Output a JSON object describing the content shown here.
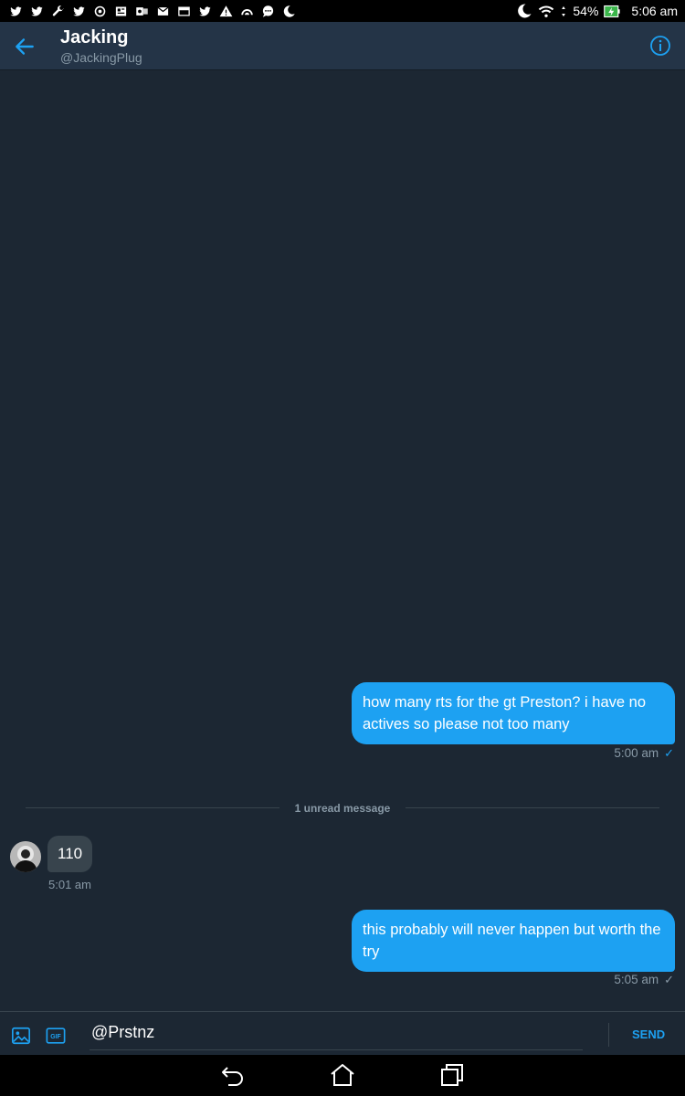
{
  "status_bar": {
    "left_icons": [
      "twitter-icon",
      "twitter-icon",
      "wrench-icon",
      "twitter-icon",
      "sync-icon",
      "news-icon",
      "outlook-icon",
      "mail-icon",
      "mail-icon",
      "twitter-icon",
      "warning-icon",
      "rainbow-icon",
      "chat-icon",
      "moon-icon"
    ],
    "battery_percent": "54%",
    "time": "5:06 am"
  },
  "header": {
    "name": "Jacking",
    "handle": "@JackingPlug"
  },
  "messages": {
    "m1": {
      "text": "how many rts for the gt Preston? i have no actives so please not too many",
      "time": "5:00 am",
      "check": "✓"
    },
    "unread_label": "1 unread message",
    "m2": {
      "text": "110",
      "time": "5:01 am"
    },
    "m3": {
      "text": "this probably will never happen but worth the try",
      "time": "5:05 am",
      "check": "✓"
    }
  },
  "composer": {
    "value": "@Prstnz",
    "send_label": "SEND"
  },
  "colors": {
    "accent": "#1da1f2",
    "background": "#1c2733",
    "header": "#243447",
    "bubble_in": "#38444d",
    "muted": "#8899a6"
  }
}
